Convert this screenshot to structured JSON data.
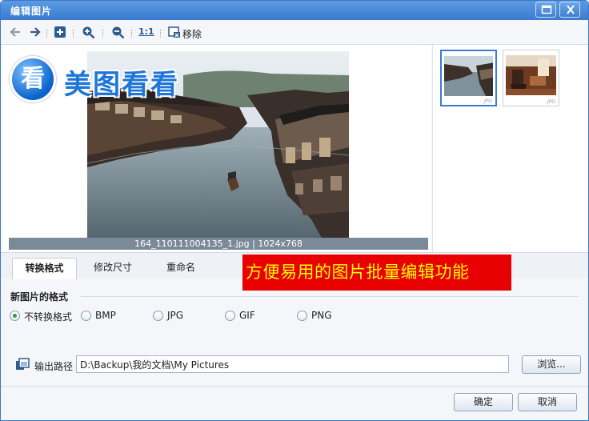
{
  "window": {
    "title": "编辑图片"
  },
  "toolbar": {
    "remove_label": "移除",
    "actual_size_label": "1:1"
  },
  "logo": {
    "mark": "看",
    "text": "美图看看"
  },
  "preview": {
    "caption": "164_110111004135_1.jpg | 1024x768"
  },
  "thumbnails": [
    {
      "badge": "JPG",
      "selected": true
    },
    {
      "badge": "JPG",
      "selected": false
    }
  ],
  "tabs": [
    "转换格式",
    "修改尺寸",
    "重命名"
  ],
  "banner": {
    "text": "方便易用的图片批量编辑功能"
  },
  "format": {
    "title": "新图片的格式",
    "options": [
      "不转换格式",
      "BMP",
      "JPG",
      "GIF",
      "PNG"
    ],
    "selected_index": 0
  },
  "output": {
    "label": "输出路径",
    "path": "D:\\Backup\\我的文档\\My Pictures",
    "browse_label": "浏览..."
  },
  "footer": {
    "ok_label": "确定",
    "cancel_label": "取消"
  },
  "colors": {
    "titlebar": "#3a7bd0",
    "banner_bg": "#e80000",
    "banner_text": "#ffff00",
    "radio_selected": "#2fa23a"
  }
}
